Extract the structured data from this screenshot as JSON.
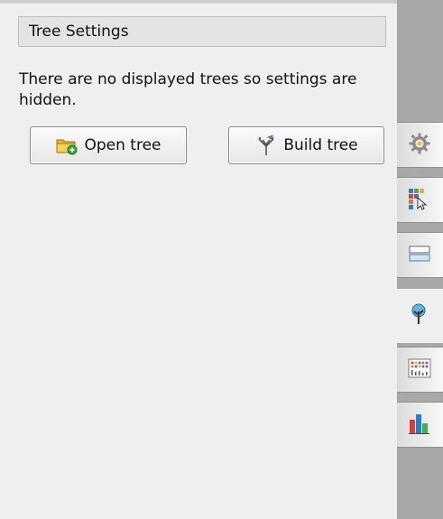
{
  "panel": {
    "section_title": "Tree Settings",
    "message": "There are no displayed trees so settings are hidden.",
    "buttons": {
      "open_label": "Open tree",
      "build_label": "Build tree"
    }
  },
  "sidebar": {
    "tabs": [
      {
        "icon": "gear-icon",
        "active": false
      },
      {
        "icon": "color-grid-pointer-icon",
        "active": false
      },
      {
        "icon": "table-rows-icon",
        "active": false
      },
      {
        "icon": "tree-icon",
        "active": true
      },
      {
        "icon": "data-matrix-icon",
        "active": false
      },
      {
        "icon": "bar-chart-icon",
        "active": false
      }
    ]
  },
  "colors": {
    "panel_bg": "#efefef",
    "sidebar_bg": "#a8a8a8",
    "folder_yellow": "#f0c23a",
    "folder_plus": "#3fa33f"
  }
}
